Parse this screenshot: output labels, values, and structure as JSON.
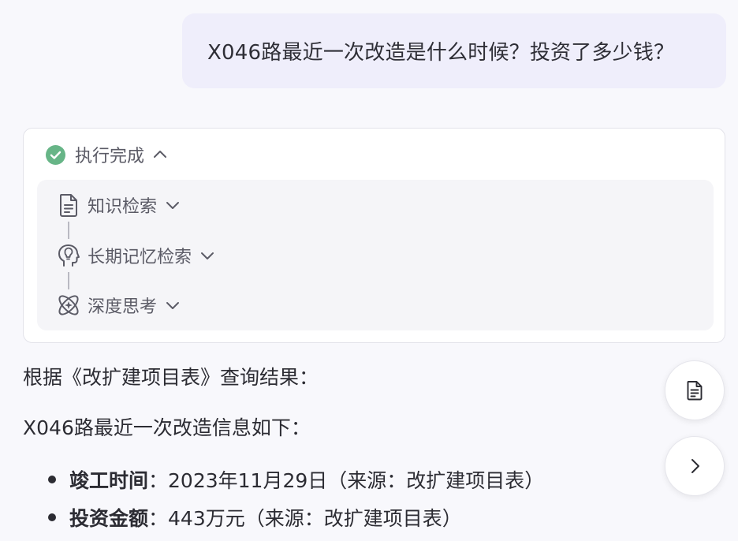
{
  "user_message": "X046路最近一次改造是什么时候？投资了多少钱？",
  "execution": {
    "status_label": "执行完成",
    "status_icon": "check-circle-icon",
    "status_color": "#67b587",
    "steps": [
      {
        "label": "知识检索",
        "icon": "document-icon"
      },
      {
        "label": "长期记忆检索",
        "icon": "brain-head-icon"
      },
      {
        "label": "深度思考",
        "icon": "atom-icon"
      }
    ]
  },
  "answer": {
    "intro": "根据《改扩建项目表》查询结果：",
    "summary": "X046路最近一次改造信息如下：",
    "items": [
      {
        "label": "竣工时间",
        "separator": "：",
        "value": "2023年11月29日（来源：改扩建项目表）"
      },
      {
        "label": "投资金额",
        "separator": "：",
        "value": "443万元（来源：改扩建项目表）"
      }
    ]
  },
  "floating_buttons": [
    {
      "icon": "document-icon"
    },
    {
      "icon": "chevron-right-icon"
    }
  ]
}
